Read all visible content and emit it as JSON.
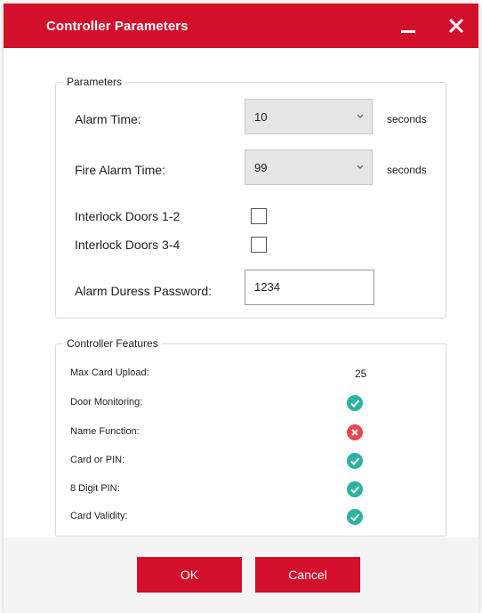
{
  "window": {
    "title": "Controller Parameters",
    "minimize_icon": "minimize-icon",
    "close_icon": "close-icon",
    "accent_color": "#d2102c"
  },
  "parameters": {
    "legend": "Parameters",
    "alarm_time": {
      "label": "Alarm Time:",
      "value": "10",
      "unit": "seconds"
    },
    "fire_alarm_time": {
      "label": "Fire Alarm Time:",
      "value": "99",
      "unit": "seconds"
    },
    "interlock_1_2": {
      "label": "Interlock Doors 1-2",
      "checked": false
    },
    "interlock_3_4": {
      "label": "Interlock Doors 3-4",
      "checked": false
    },
    "duress_password": {
      "label": "Alarm Duress Password:",
      "value": "1234"
    }
  },
  "features": {
    "legend": "Controller Features",
    "items": [
      {
        "label": "Max Card Upload:",
        "value": "25"
      },
      {
        "label": "Door Monitoring:",
        "status": "enabled",
        "icon": "check-circle-icon"
      },
      {
        "label": "Name Function:",
        "status": "disabled",
        "icon": "x-circle-icon"
      },
      {
        "label": "Card or PIN:",
        "status": "enabled",
        "icon": "check-circle-icon"
      },
      {
        "label": "8 Digit PIN:",
        "status": "enabled",
        "icon": "check-circle-icon"
      },
      {
        "label": "Card Validity:",
        "status": "enabled",
        "icon": "check-circle-icon"
      }
    ],
    "enabled_color": "#2bb3a0",
    "disabled_color": "#e8474f"
  },
  "footer": {
    "ok_label": "OK",
    "cancel_label": "Cancel"
  }
}
